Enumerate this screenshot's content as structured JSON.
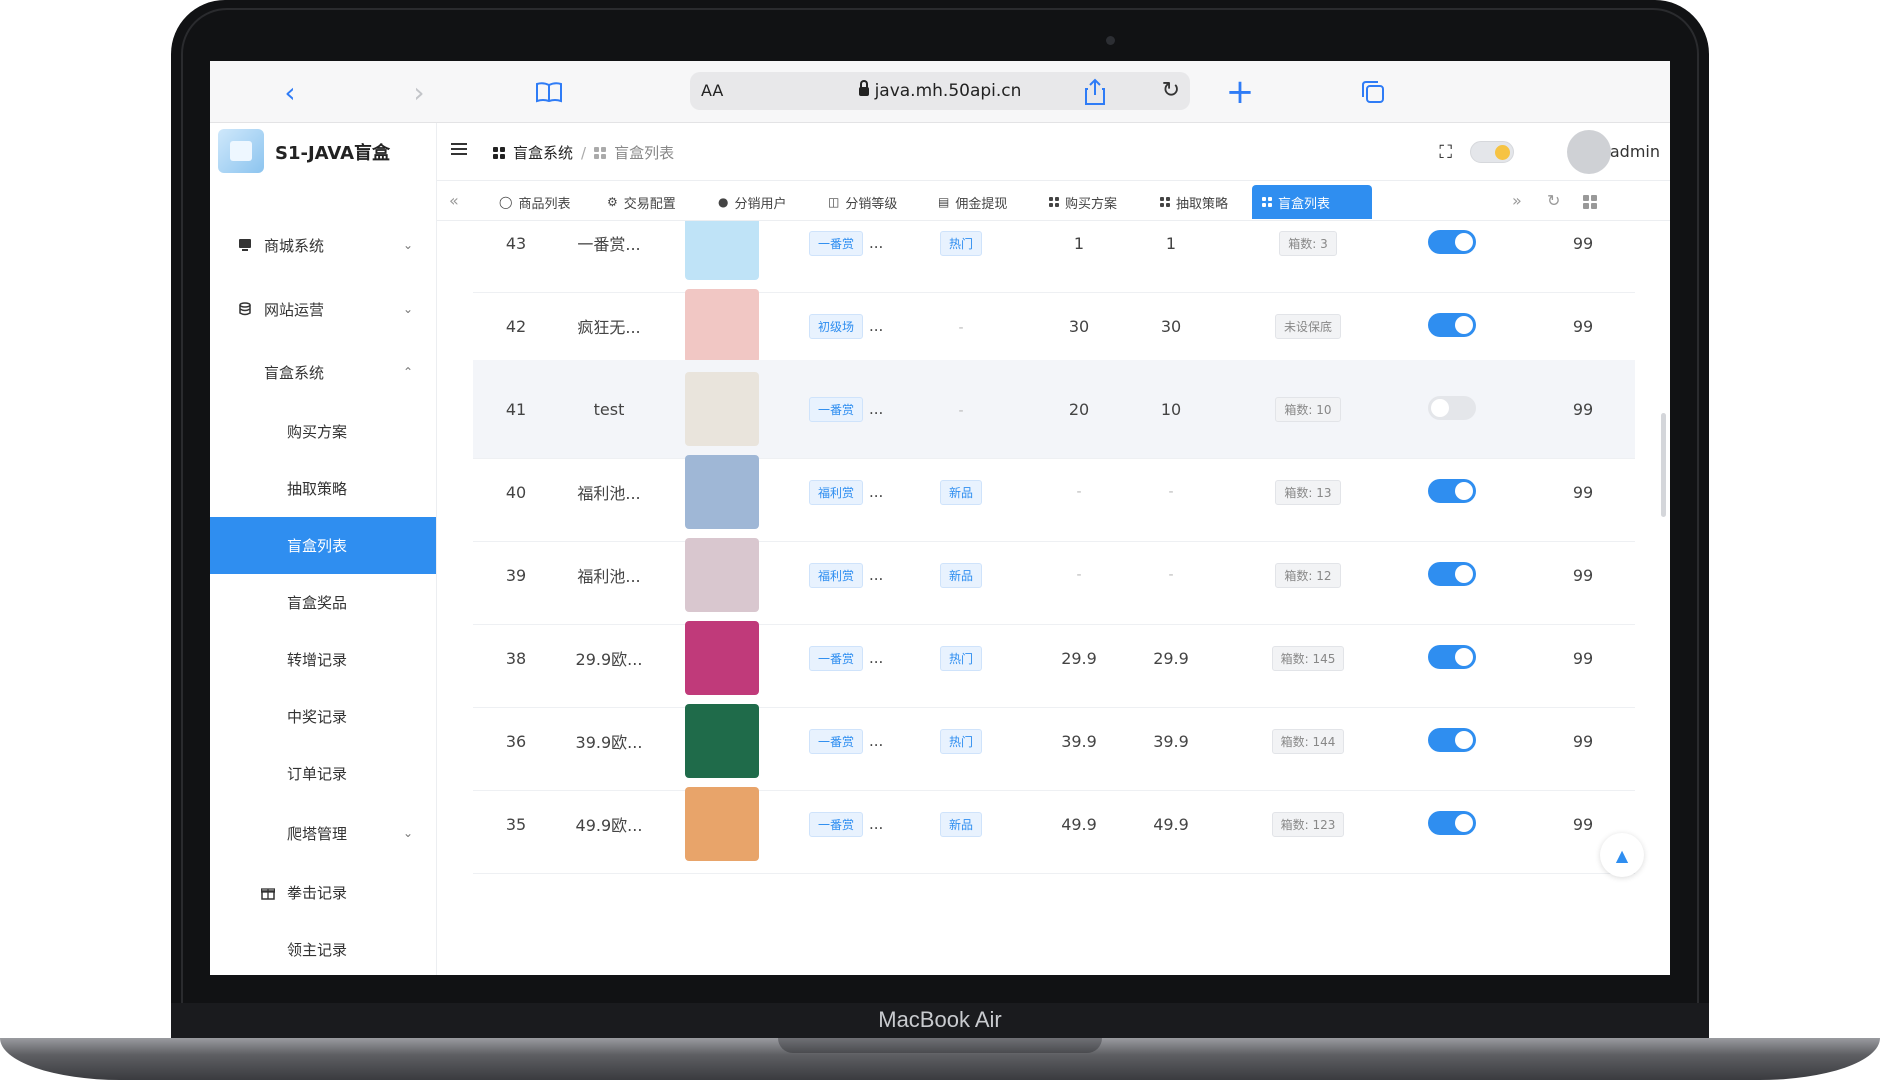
{
  "device": {
    "brand_label": "MacBook Air"
  },
  "browser": {
    "aa_label": "AA",
    "url": "java.mh.50api.cn"
  },
  "app": {
    "title": "S1-JAVA盲盒"
  },
  "sidebar": {
    "items": [
      {
        "label": "商城系统",
        "type": "group",
        "expanded": false
      },
      {
        "label": "网站运营",
        "type": "group",
        "expanded": false
      },
      {
        "label": "盲盒系统",
        "type": "group",
        "expanded": true
      },
      {
        "label": "购买方案",
        "type": "sub"
      },
      {
        "label": "抽取策略",
        "type": "sub"
      },
      {
        "label": "盲盒列表",
        "type": "sub",
        "active": true
      },
      {
        "label": "盲盒奖品",
        "type": "sub"
      },
      {
        "label": "转增记录",
        "type": "sub"
      },
      {
        "label": "中奖记录",
        "type": "sub"
      },
      {
        "label": "订单记录",
        "type": "sub"
      },
      {
        "label": "爬塔管理",
        "type": "sub",
        "expandable": true
      },
      {
        "label": "拳击记录",
        "type": "sub"
      },
      {
        "label": "领主记录",
        "type": "sub"
      }
    ]
  },
  "header": {
    "breadcrumb": {
      "parent": "盲盒系统",
      "current": "盲盒列表"
    },
    "username": "admin"
  },
  "tabs": [
    {
      "label": "商品列表",
      "icon": "refresh-icon"
    },
    {
      "label": "交易配置",
      "icon": "gear-icon"
    },
    {
      "label": "分销用户",
      "icon": "user-icon"
    },
    {
      "label": "分销等级",
      "icon": "cup-icon"
    },
    {
      "label": "佣金提现",
      "icon": "card-icon"
    },
    {
      "label": "购买方案",
      "icon": "grid-icon"
    },
    {
      "label": "抽取策略",
      "icon": "grid-icon"
    },
    {
      "label": "盲盒列表",
      "icon": "grid-icon",
      "active": true
    }
  ],
  "table": {
    "rows": [
      {
        "id": "43",
        "name": "一番赏...",
        "tag1": "一番赏",
        "tag2": "热门",
        "p1": "1",
        "p2": "1",
        "count": "箱数: 3",
        "enabled": true,
        "sort": "99",
        "img": "#bfe3f7"
      },
      {
        "id": "42",
        "name": "疯狂无...",
        "tag1": "初级场",
        "tag2": "-",
        "p1": "30",
        "p2": "30",
        "count": "未设保底",
        "enabled": true,
        "sort": "99",
        "img": "#f1c7c4"
      },
      {
        "id": "41",
        "name": "test",
        "tag1": "一番赏",
        "tag2": "-",
        "p1": "20",
        "p2": "10",
        "count": "箱数: 10",
        "enabled": false,
        "sort": "99",
        "img": "#e9e4dc"
      },
      {
        "id": "40",
        "name": "福利池...",
        "tag1": "福利赏",
        "tag2": "新品",
        "p1": "-",
        "p2": "-",
        "count": "箱数: 13",
        "enabled": true,
        "sort": "99",
        "img": "#9fb7d6"
      },
      {
        "id": "39",
        "name": "福利池...",
        "tag1": "福利赏",
        "tag2": "新品",
        "p1": "-",
        "p2": "-",
        "count": "箱数: 12",
        "enabled": true,
        "sort": "99",
        "img": "#d9c7cf"
      },
      {
        "id": "38",
        "name": "29.9欧...",
        "tag1": "一番赏",
        "tag2": "热门",
        "p1": "29.9",
        "p2": "29.9",
        "count": "箱数: 145",
        "enabled": true,
        "sort": "99",
        "img": "#c03a7a"
      },
      {
        "id": "36",
        "name": "39.9欧...",
        "tag1": "一番赏",
        "tag2": "热门",
        "p1": "39.9",
        "p2": "39.9",
        "count": "箱数: 144",
        "enabled": true,
        "sort": "99",
        "img": "#1f6b4a"
      },
      {
        "id": "35",
        "name": "49.9欧...",
        "tag1": "一番赏",
        "tag2": "新品",
        "p1": "49.9",
        "p2": "49.9",
        "count": "箱数: 123",
        "enabled": true,
        "sort": "99",
        "img": "#e8a46a"
      }
    ],
    "ellipsis": "..."
  },
  "colors": {
    "accent": "#2f8ef0",
    "laptop_frame": "#111214"
  }
}
